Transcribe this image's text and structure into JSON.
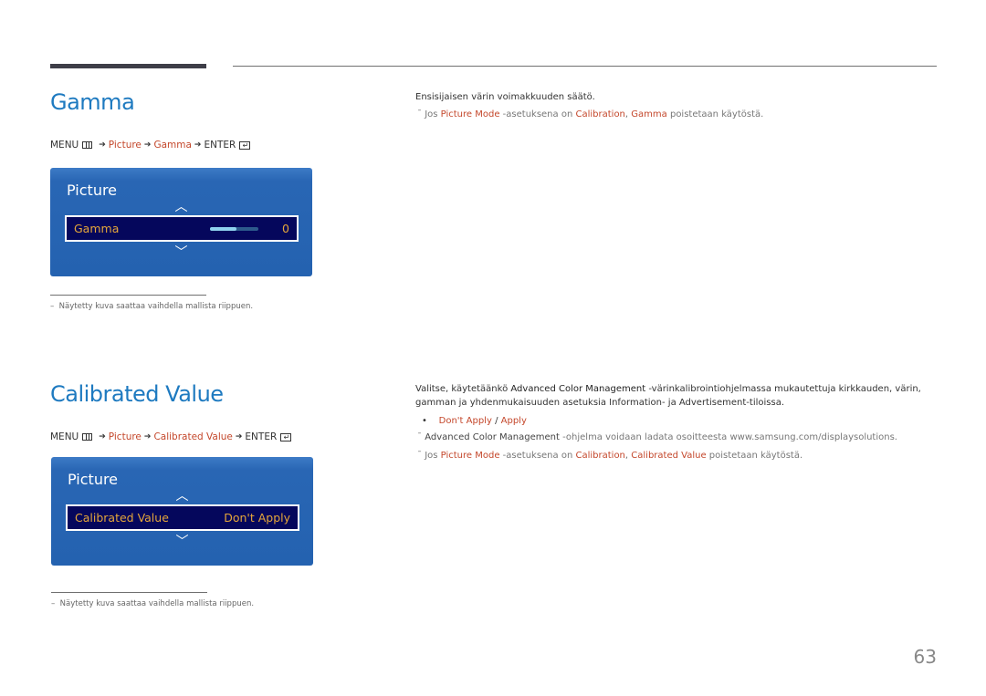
{
  "sections": [
    {
      "title": "Gamma",
      "path": {
        "menu": "MENU",
        "picture": "Picture",
        "item": "Gamma",
        "enter": "ENTER"
      },
      "osd": {
        "header": "Picture",
        "item_label": "Gamma",
        "item_value": "0",
        "slider_fraction": 0.55
      },
      "footnote": "Näytetty kuva saattaa vaihdella mallista riippuen.",
      "description": "Ensisijaisen värin voimakkuuden säätö.",
      "note": {
        "prefix": "Jos",
        "mode": "Picture Mode",
        "mid": "-asetuksena on",
        "calibration": "Calibration",
        "comma": ",",
        "item": "Gamma",
        "suffix": "poistetaan käytöstä."
      }
    },
    {
      "title": "Calibrated Value",
      "path": {
        "menu": "MENU",
        "picture": "Picture",
        "item": "Calibrated Value",
        "enter": "ENTER"
      },
      "osd": {
        "header": "Picture",
        "item_label": "Calibrated Value",
        "item_value": "Don't Apply"
      },
      "footnote": "Näytetty kuva saattaa vaihdella mallista riippuen.",
      "description": {
        "p1": "Valitse, käytetäänkö",
        "acm": "Advanced Color Management",
        "p2": "-värinkalibrointiohjelmassa mukautettuja kirkkauden, värin, gamman ja yhdenmukaisuuden asetuksia Information- ja Advertisement-tiloissa."
      },
      "options": {
        "opt1": "Don't Apply",
        "sep": "/",
        "opt2": "Apply"
      },
      "note1": {
        "acm": "Advanced Color Management",
        "text": "-ohjelma voidaan ladata osoitteesta www.samsung.com/displaysolutions."
      },
      "note2": {
        "prefix": "Jos",
        "mode": "Picture Mode",
        "mid": "-asetuksena on",
        "calibration": "Calibration",
        "comma": ",",
        "item": "Calibrated Value",
        "suffix": "poistetaan käytöstä."
      }
    }
  ],
  "page_number": "63",
  "colors": {
    "heading": "#1e7ac0",
    "highlight": "#c4472b",
    "osd_bg": "#2462b0",
    "osd_selected": "#05075c",
    "osd_text": "#e5a63a"
  }
}
